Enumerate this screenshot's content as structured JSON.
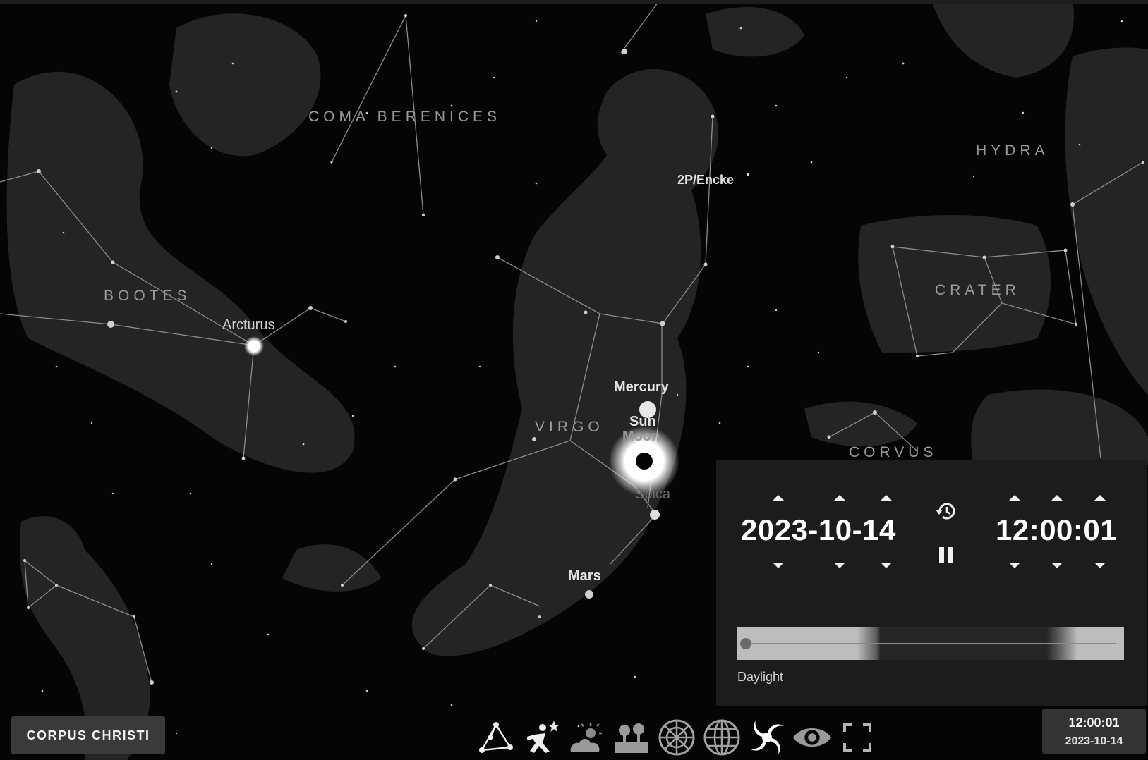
{
  "constellations": {
    "coma_berenices": "COMA BERENICES",
    "hydra": "HYDRA",
    "bootes": "BOOTES",
    "crater": "CRATER",
    "virgo": "VIRGO",
    "corvus": "CORVUS"
  },
  "objects": {
    "comet": "2P/Encke",
    "arcturus": "Arcturus",
    "mercury": "Mercury",
    "sun": "Sun",
    "moon": "Moon",
    "spica": "Spica",
    "mars": "Mars"
  },
  "time_panel": {
    "date": "2023-10-14",
    "time": "12:00:01",
    "daylight_label": "Daylight",
    "daylight_position": 0.0
  },
  "location": "CORPUS CHRISTI",
  "clock": {
    "time": "12:00:01",
    "date": "2023-10-14"
  },
  "toolbar": [
    {
      "icon": "constellation-lines-icon"
    },
    {
      "icon": "constellation-art-icon"
    },
    {
      "icon": "atmosphere-icon"
    },
    {
      "icon": "landscape-icon"
    },
    {
      "icon": "azimuthal-grid-icon"
    },
    {
      "icon": "equatorial-grid-icon"
    },
    {
      "icon": "deep-sky-objects-icon"
    },
    {
      "icon": "night-mode-icon"
    },
    {
      "icon": "fullscreen-icon"
    }
  ]
}
